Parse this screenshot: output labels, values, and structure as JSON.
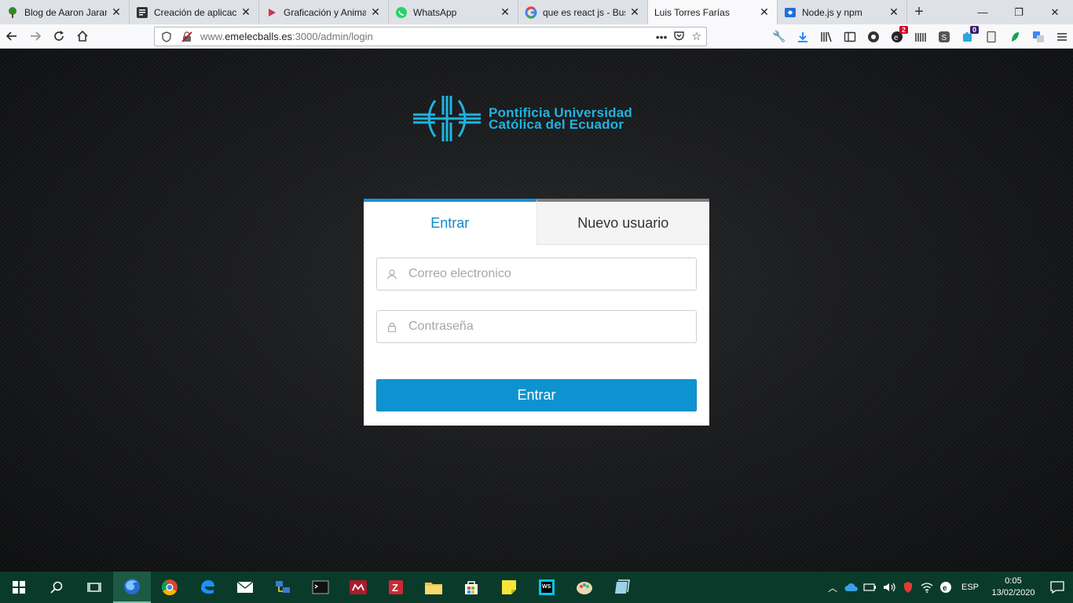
{
  "browser": {
    "tabs": [
      {
        "title": "Blog de Aaron Jaramillo",
        "favicon": "tree-icon",
        "color": "#2e8b2e"
      },
      {
        "title": "Creación de aplicaciones",
        "favicon": "doc-icon",
        "color": "#333333"
      },
      {
        "title": "Graficación y Animación",
        "favicon": "play-icon",
        "color": "#d0314f"
      },
      {
        "title": "WhatsApp",
        "favicon": "whatsapp-icon",
        "color": "#25d366"
      },
      {
        "title": "que es react js - Buscar",
        "favicon": "google-icon",
        "color": "#4285f4"
      },
      {
        "title": "Luis Torres Farías",
        "favicon": "none",
        "color": "#ffffff",
        "active": true
      },
      {
        "title": "Node.js y npm",
        "favicon": "codigofacilito-icon",
        "color": "#1e6fd9"
      }
    ],
    "url": {
      "prefix": "www.",
      "host": "emelecballs.es",
      "rest": ":3000/admin/login"
    },
    "extension_badges": {
      "ext1": "2",
      "ext2": "0"
    }
  },
  "page": {
    "logo": {
      "line1": "Pontificia Universidad",
      "line2": "Católica del Ecuador",
      "color": "#1fb4e0"
    },
    "login": {
      "tab_login": "Entrar",
      "tab_register": "Nuevo usuario",
      "email_placeholder": "Correo electronico",
      "password_placeholder": "Contraseña",
      "submit_label": "Entrar",
      "accent": "#0e93d1"
    }
  },
  "taskbar": {
    "language": "ESP",
    "time": "0:05",
    "date": "13/02/2020"
  }
}
